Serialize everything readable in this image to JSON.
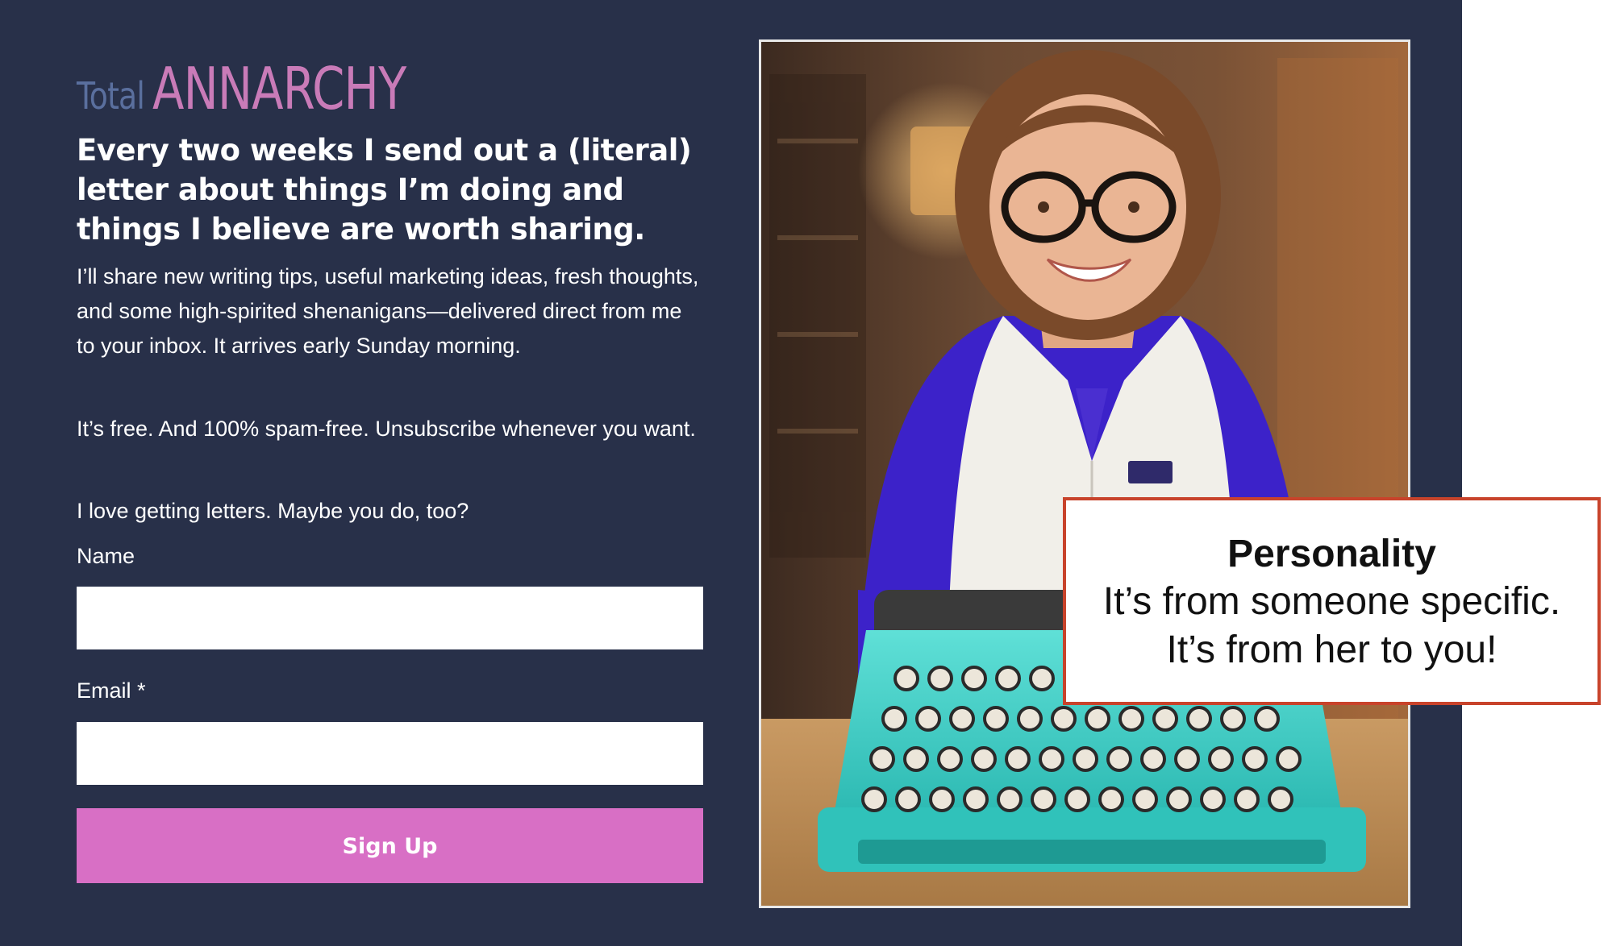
{
  "brand": {
    "prefix": "Total",
    "name": "ANNARCHY"
  },
  "headline": "Every two weeks I send out a (literal) letter about things I’m doing and things I believe are worth sharing.",
  "paragraphs": [
    "I’ll share new writing tips, useful marketing ideas, fresh thoughts, and some high-spirited shenanigans—delivered direct from me to your inbox. It arrives early Sunday morning.",
    "It’s free. And 100% spam-free. Unsubscribe whenever you want.",
    "I love getting letters. Maybe you do, too?"
  ],
  "form": {
    "name_label": "Name",
    "name_value": "",
    "email_label": "Email *",
    "email_value": "",
    "submit_label": "Sign Up"
  },
  "callout": {
    "title": "Personality",
    "lines": [
      "It’s from someone specific.",
      "It’s from her to you!"
    ]
  },
  "colors": {
    "panel_bg": "#283049",
    "brand_prefix": "#5a6f9e",
    "brand_name": "#c97bb8",
    "button_bg": "#d86fc5",
    "callout_border": "#c8432b"
  }
}
